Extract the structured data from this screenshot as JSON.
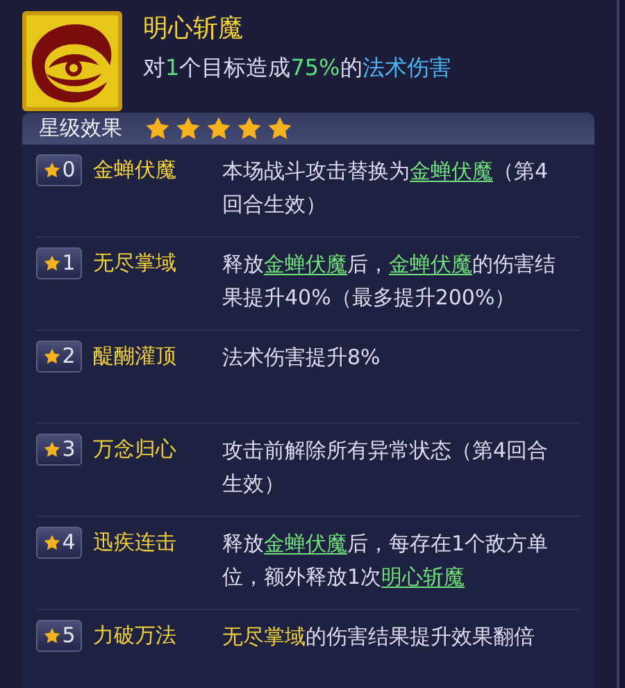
{
  "skill": {
    "name": "明心斩魔",
    "summary": [
      {
        "text": "对",
        "kind": "plain"
      },
      {
        "text": "1",
        "kind": "number"
      },
      {
        "text": "个目标造成",
        "kind": "plain"
      },
      {
        "text": "75%",
        "kind": "number"
      },
      {
        "text": "的",
        "kind": "plain"
      },
      {
        "text": "法术伤害",
        "kind": "term"
      }
    ]
  },
  "star_effects": {
    "title": "星级效果",
    "stars": 5,
    "rows": [
      {
        "level": "0",
        "name": "金蝉伏魔",
        "description": [
          {
            "text": "本场战斗攻击替换为",
            "kind": "plain"
          },
          {
            "text": "金蝉伏魔",
            "kind": "link"
          },
          {
            "text": "（第4回合生效）",
            "kind": "plain"
          }
        ]
      },
      {
        "level": "1",
        "name": "无尽掌域",
        "description": [
          {
            "text": "释放",
            "kind": "plain"
          },
          {
            "text": "金蝉伏魔",
            "kind": "link"
          },
          {
            "text": "后，",
            "kind": "plain"
          },
          {
            "text": "金蝉伏魔",
            "kind": "link"
          },
          {
            "text": "的伤害结果提升40%（最多提升200%）",
            "kind": "plain"
          }
        ]
      },
      {
        "level": "2",
        "name": "醍醐灌顶",
        "description": [
          {
            "text": "法术伤害提升8%",
            "kind": "plain"
          }
        ]
      },
      {
        "level": "3",
        "name": "万念归心",
        "description": [
          {
            "text": "攻击前解除所有异常状态（第4回合生效）",
            "kind": "plain"
          }
        ]
      },
      {
        "level": "4",
        "name": "迅疾连击",
        "description": [
          {
            "text": "释放",
            "kind": "plain"
          },
          {
            "text": "金蝉伏魔",
            "kind": "link"
          },
          {
            "text": "后，每存在1个敌方单位，额外释放1次",
            "kind": "plain"
          },
          {
            "text": "明心斩魔",
            "kind": "link"
          }
        ]
      },
      {
        "level": "5",
        "name": "力破万法",
        "description": [
          {
            "text": "无尽掌域",
            "kind": "highlight"
          },
          {
            "text": "的伤害结果提升效果翻倍",
            "kind": "plain"
          }
        ]
      }
    ]
  }
}
